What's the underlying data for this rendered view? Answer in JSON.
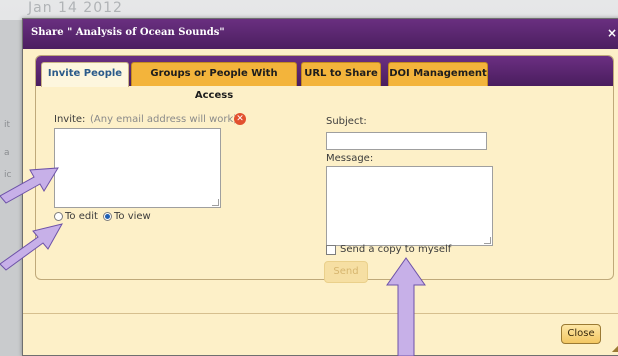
{
  "background": {
    "date_text": "Jan 14 2012"
  },
  "dialog": {
    "title": "Share \" Analysis of Ocean Sounds\"",
    "close_x": "×",
    "tabs": [
      {
        "label": "Invite People",
        "active": true
      },
      {
        "label": "Groups or People With Access",
        "active": false
      },
      {
        "label": "URL to Share",
        "active": false
      },
      {
        "label": "DOI Management",
        "active": false
      }
    ],
    "invite": {
      "label": "Invite:",
      "hint": "(Any email address will work)",
      "error_icon": "x-circle-icon",
      "value": ""
    },
    "permissions": {
      "to_edit_label": "To edit",
      "to_view_label": "To view",
      "selected": "To view"
    },
    "subject": {
      "label": "Subject:",
      "value": ""
    },
    "message": {
      "label": "Message:",
      "value": ""
    },
    "send_copy": {
      "label": "Send a copy to myself",
      "checked": false
    },
    "send_button": "Send",
    "close_button": "Close"
  },
  "colors": {
    "title_bar": "#5a2670",
    "tab_active": "#fdf6de",
    "tab_inactive": "#f3b43b",
    "panel_bg": "#fdf0c8",
    "annotation_arrow": "#c7b0e8"
  }
}
